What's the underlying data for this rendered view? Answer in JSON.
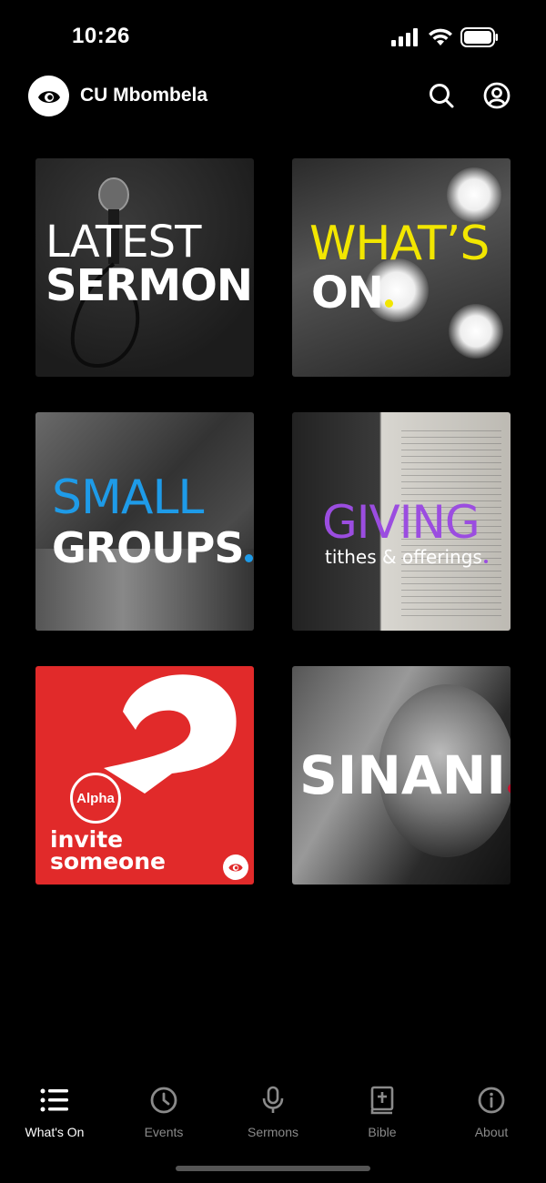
{
  "status_bar": {
    "time": "10:26"
  },
  "header": {
    "title": "CU Mbombela"
  },
  "tiles": [
    {
      "line1": "LATEST",
      "line2": "SERMONS",
      "dot_color": "#7ed321"
    },
    {
      "line1": "WHAT’S",
      "line2": "ON",
      "dot_color": "#f2e600"
    },
    {
      "line1": "SMALL",
      "line2": "GROUPS",
      "dot_color": "#1e9be8"
    },
    {
      "line1": "GIVING",
      "line2": "tithes & offerings",
      "dot_color": "#9b4de0"
    },
    {
      "badge": "Alpha",
      "line1": "invite",
      "line2": "someone",
      "background": "#e12a2a"
    },
    {
      "line1": "SINANI",
      "dot_color": "#c8102e"
    }
  ],
  "accent_colors": {
    "green": "#7ed321",
    "yellow": "#f2e600",
    "blue": "#1e9be8",
    "purple": "#9b4de0",
    "red": "#c8102e"
  },
  "tabbar": {
    "items": [
      {
        "label": "What's On",
        "icon": "list-icon",
        "active": true
      },
      {
        "label": "Events",
        "icon": "clock-icon",
        "active": false
      },
      {
        "label": "Sermons",
        "icon": "microphone-icon",
        "active": false
      },
      {
        "label": "Bible",
        "icon": "bible-icon",
        "active": false
      },
      {
        "label": "About",
        "icon": "info-icon",
        "active": false
      }
    ]
  }
}
